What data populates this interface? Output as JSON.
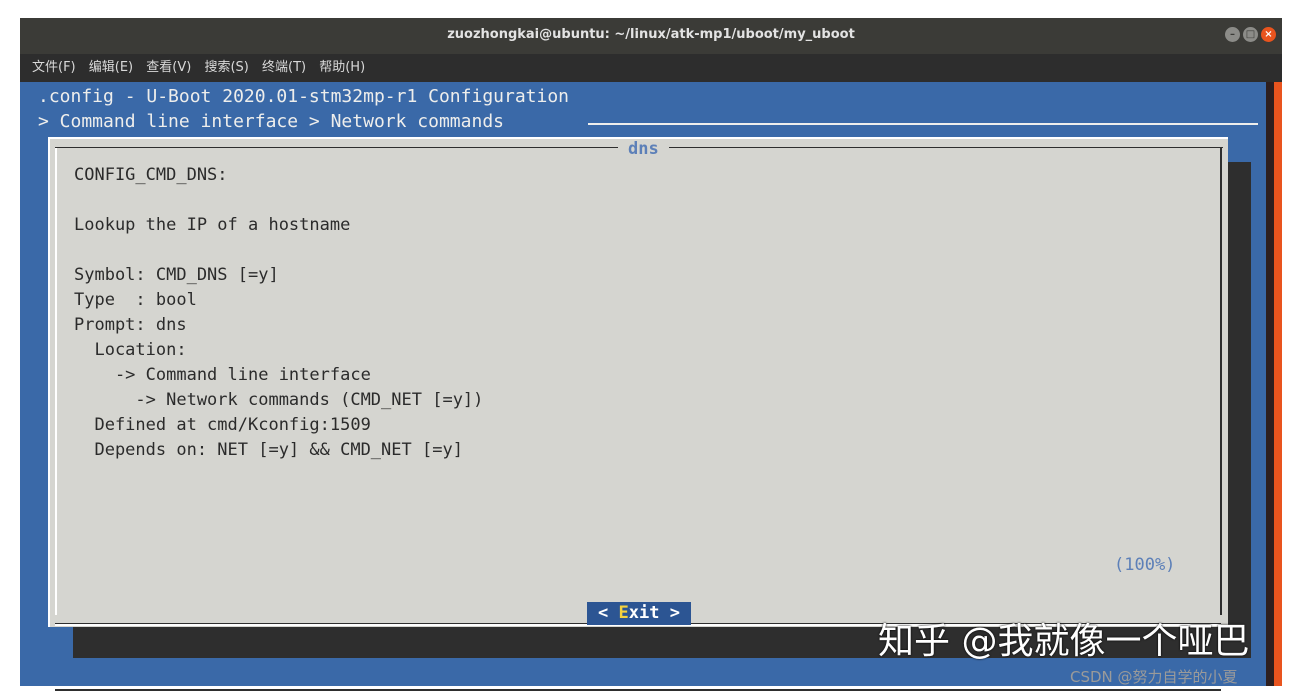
{
  "window": {
    "title": "zuozhongkai@ubuntu: ~/linux/atk-mp1/uboot/my_uboot",
    "controls": [
      "–",
      "□",
      "×"
    ]
  },
  "menu": {
    "items": [
      "文件(F)",
      "编辑(E)",
      "查看(V)",
      "搜索(S)",
      "终端(T)",
      "帮助(H)"
    ]
  },
  "terminal": {
    "config_title": ".config - U-Boot 2020.01-stm32mp-r1 Configuration",
    "breadcrumb": "> Command line interface > Network commands"
  },
  "dialog": {
    "title": "dns",
    "lines": [
      "CONFIG_CMD_DNS:",
      "",
      "Lookup the IP of a hostname",
      "",
      "Symbol: CMD_DNS [=y]",
      "Type  : bool",
      "Prompt: dns",
      "  Location:",
      "    -> Command line interface",
      "      -> Network commands (CMD_NET [=y])",
      "  Defined at cmd/Kconfig:1509",
      "  Depends on: NET [=y] && CMD_NET [=y]"
    ],
    "scroll_percent": "(100%)",
    "exit_button": {
      "left": "< ",
      "hotkey": "E",
      "rest": "xit",
      "right": " >"
    }
  },
  "watermarks": {
    "zhihu": "知乎 @我就像一个哑巴",
    "csdn": "CSDN @努力自学的小夏"
  },
  "colors": {
    "terminal_bg": "#3a69a8",
    "dialog_bg": "#d5d5d0",
    "button_bg": "#2c5593",
    "hotkey": "#f5d23e",
    "close_button": "#e9541e"
  }
}
